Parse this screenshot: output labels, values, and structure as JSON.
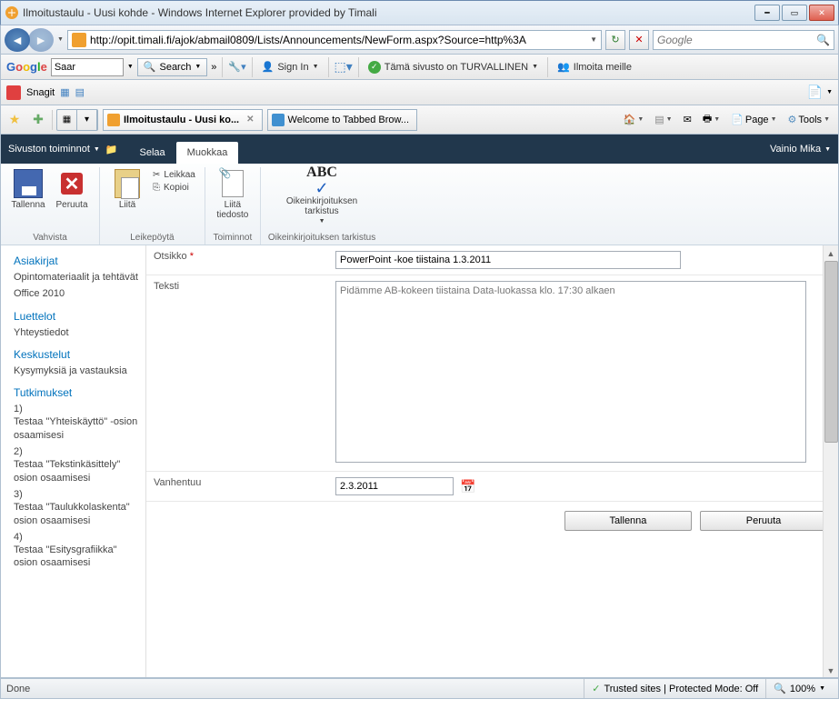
{
  "window": {
    "title": "Ilmoitustaulu - Uusi kohde - Windows Internet Explorer provided by Timali"
  },
  "nav": {
    "url": "http://opit.timali.fi/ajok/abmail0809/Lists/Announcements/NewForm.aspx?Source=http%3A",
    "search_placeholder": "Google"
  },
  "googlebar": {
    "logo_text": "Google",
    "input": "Saar",
    "search": "Search",
    "signin": "Sign In",
    "safe": "Tämä sivusto on TURVALLINEN",
    "report": "Ilmoita meille"
  },
  "snagit": {
    "label": "Snagit"
  },
  "tabs": {
    "active": "Ilmoitustaulu - Uusi ko...",
    "second": "Welcome to Tabbed Brow..."
  },
  "cmdbar": {
    "page": "Page",
    "tools": "Tools"
  },
  "sp": {
    "siteactions": "Sivuston toiminnot",
    "browse": "Selaa",
    "edit": "Muokkaa",
    "user": "Vainio Mika"
  },
  "ribbon": {
    "save": "Tallenna",
    "cancel": "Peruuta",
    "commit_group": "Vahvista",
    "paste": "Liitä",
    "cut": "Leikkaa",
    "copy": "Kopioi",
    "clipboard_group": "Leikepöytä",
    "attach": "Liitä tiedosto",
    "actions_group": "Toiminnot",
    "abc": "ABC",
    "spell": "Oikeinkirjoituksen tarkistus",
    "spell_group": "Oikeinkirjoituksen tarkistus"
  },
  "leftnav": {
    "docs": "Asiakirjat",
    "docs_items": [
      "Opintomateriaalit ja tehtävät",
      "Office 2010"
    ],
    "lists": "Luettelot",
    "lists_items": [
      "Yhteystiedot"
    ],
    "disc": "Keskustelut",
    "disc_items": [
      "Kysymyksiä ja vastauksia"
    ],
    "surveys": "Tutkimukset",
    "surveys_items": [
      "1)\nTestaa \"Yhteiskäyttö\" -osion osaamisesi",
      "2)\nTestaa \"Tekstinkäsittely\" osion osaamisesi",
      "3)\nTestaa \"Taulukkolaskenta\" osion osaamisesi",
      "4)\nTestaa \"Esitysgrafiikka\" osion osaamisesi"
    ]
  },
  "form": {
    "title_label": "Otsikko",
    "title_value": "PowerPoint -koe tiistaina 1.3.2011",
    "body_label": "Teksti",
    "body_value": "Pidämme AB-kokeen tiistaina Data-luokassa klo. 17:30 alkaen",
    "expires_label": "Vanhentuu",
    "expires_value": "2.3.2011",
    "save_btn": "Tallenna",
    "cancel_btn": "Peruuta"
  },
  "status": {
    "done": "Done",
    "security": "Trusted sites | Protected Mode: Off",
    "zoom": "100%"
  }
}
